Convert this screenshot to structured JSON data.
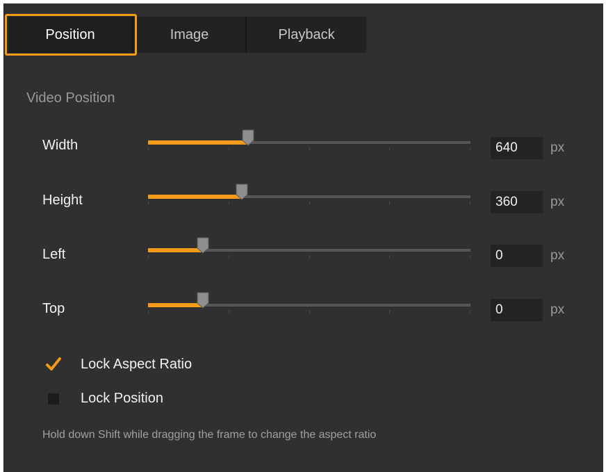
{
  "tabs": [
    {
      "label": "Position",
      "active": true
    },
    {
      "label": "Image",
      "active": false
    },
    {
      "label": "Playback",
      "active": false
    }
  ],
  "section_title": "Video Position",
  "fields": [
    {
      "label": "Width",
      "value": "640",
      "unit": "px",
      "slider_level": 0.31
    },
    {
      "label": "Height",
      "value": "360",
      "unit": "px",
      "slider_level": 0.29
    },
    {
      "label": "Left",
      "value": "0",
      "unit": "px",
      "slider_level": 0.17
    },
    {
      "label": "Top",
      "value": "0",
      "unit": "px",
      "slider_level": 0.17
    }
  ],
  "checkboxes": [
    {
      "label": "Lock Aspect Ratio",
      "checked": true
    },
    {
      "label": "Lock Position",
      "checked": false
    }
  ],
  "hint": "Hold down Shift while dragging the frame to change the aspect ratio",
  "colors": {
    "accent": "#f39b18",
    "panel_bg": "#303030",
    "track": "#575757",
    "thumb": "#8f8f8f"
  }
}
